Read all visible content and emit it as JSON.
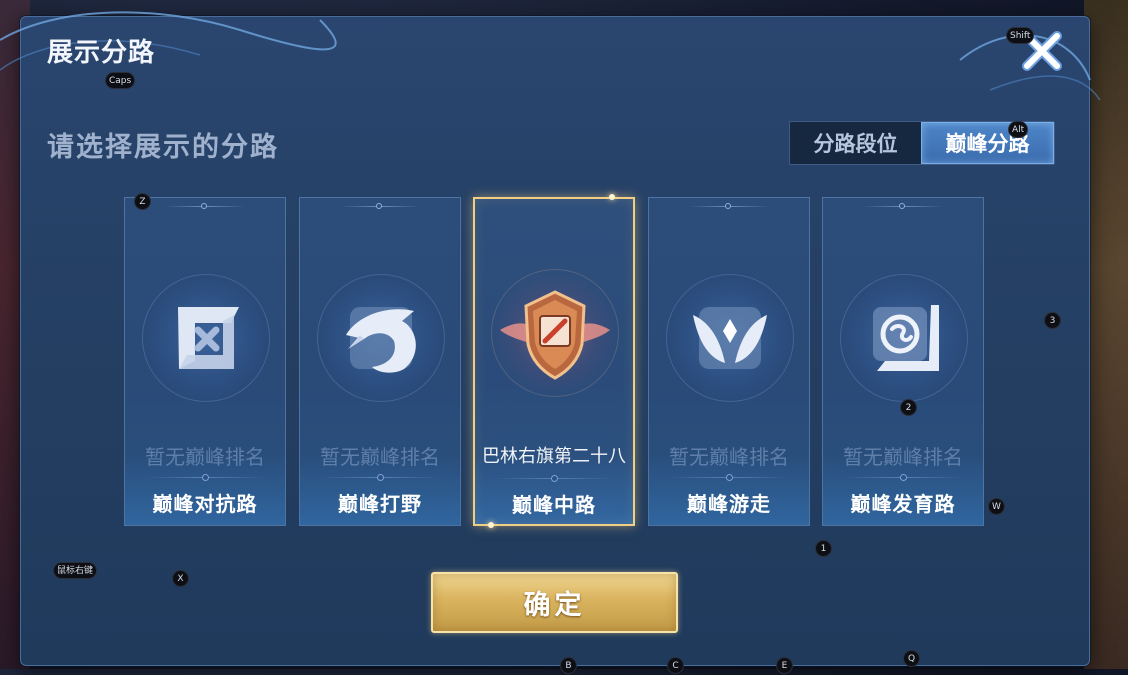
{
  "panel": {
    "title": "展示分路",
    "subtitle": "请选择展示的分路"
  },
  "toggle": {
    "options": [
      {
        "label": "分路段位",
        "active": false
      },
      {
        "label": "巅峰分路",
        "active": true
      }
    ]
  },
  "cards": [
    {
      "name": "巅峰对抗路",
      "rank": "暂无巅峰排名",
      "icon": "swords-icon",
      "selected": false
    },
    {
      "name": "巅峰打野",
      "rank": "暂无巅峰排名",
      "icon": "dragon-icon",
      "selected": false
    },
    {
      "name": "巅峰中路",
      "rank": "巴林右旗第二十八",
      "icon": "bronze-shield-badge-icon",
      "selected": true
    },
    {
      "name": "巅峰游走",
      "rank": "暂无巅峰排名",
      "icon": "wings-icon",
      "selected": false
    },
    {
      "name": "巅峰发育路",
      "rank": "暂无巅峰排名",
      "icon": "target-icon",
      "selected": false
    }
  ],
  "confirm_label": "确定",
  "key_hints": {
    "caps": "Caps",
    "shift": "Shift",
    "alt": "Alt",
    "z": "Z",
    "three": "3",
    "two": "2",
    "w": "W",
    "one": "1",
    "mouse_right": "鼠标右键",
    "x": "X",
    "b": "B",
    "c": "C",
    "e": "E",
    "q": "Q"
  },
  "colors": {
    "panel_bg": "#254064",
    "accent_gold": "#f0cf84",
    "toggle_active": "#4e86c8"
  }
}
